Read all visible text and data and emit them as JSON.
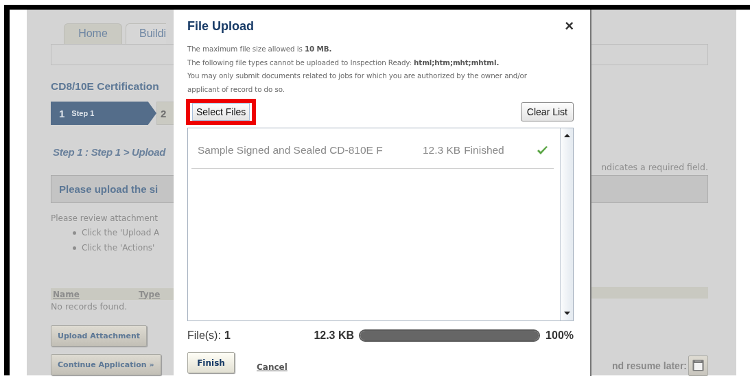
{
  "background": {
    "tabs": [
      {
        "label": "Home",
        "selected": false
      },
      {
        "label": "Buildi",
        "selected": true
      }
    ],
    "title": "CD8/10E Certification",
    "steps": [
      {
        "number": "1",
        "label": "Step 1",
        "selected": true
      },
      {
        "number": "2",
        "selected": false
      }
    ],
    "breadcrumb": "Step 1 : Step 1 > Upload",
    "required_note": "ndicates a required field.",
    "section_heading": "Please upload the si",
    "instructions": "Please review attachment",
    "bullets": [
      "Click the 'Upload A",
      "Click the 'Actions'"
    ],
    "table": {
      "columns": [
        "Name",
        "Type"
      ],
      "empty_text": "No records found."
    },
    "buttons": [
      "Upload Attachment",
      "Continue Application »"
    ],
    "save_label": "nd resume later:"
  },
  "dialog": {
    "title": "File Upload",
    "close": "×",
    "notes": [
      "The maximum file size allowed is **10 MB.**",
      "The following file types cannot be uploaded to Inspection Ready: **html;htm;mht;mhtml.**",
      "You may only submit documents related to jobs for which you are authorized by the owner and/or applicant of record to do so."
    ],
    "select_button": {
      "label": "Select Files",
      "highlighted": true
    },
    "clear_button": "Clear List",
    "files": [
      {
        "name": "Sample Signed and Sealed CD-810E F",
        "size": "12.3 KB",
        "status": "Finished",
        "done": true
      }
    ],
    "summary": {
      "count_label": "File(s):",
      "count": "1",
      "total": "12.3 KB",
      "level": 1,
      "percent": "100%"
    },
    "finish": "Finish",
    "cancel": "Cancel"
  }
}
